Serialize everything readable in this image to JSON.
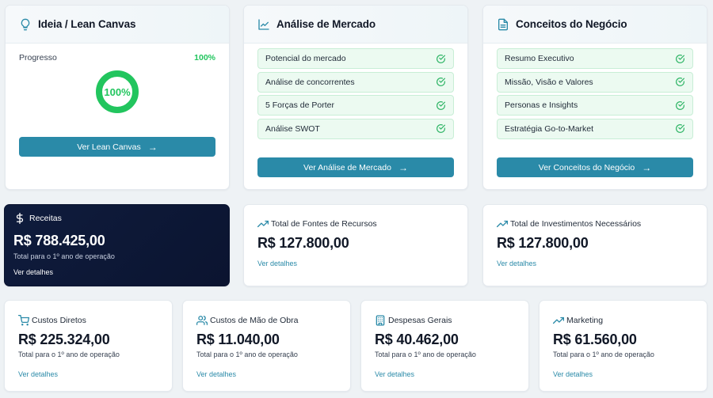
{
  "lean_canvas": {
    "title": "Ideia / Lean Canvas",
    "progress_label": "Progresso",
    "progress_value": "100%",
    "progress_fraction": 1.0,
    "ring_text": "100%",
    "button_label": "Ver Lean Canvas"
  },
  "market": {
    "title": "Análise de Mercado",
    "items": [
      {
        "label": "Potencial do mercado"
      },
      {
        "label": "Análise de concorrentes"
      },
      {
        "label": "5 Forças de Porter"
      },
      {
        "label": "Análise SWOT"
      }
    ],
    "button_label": "Ver Análise de Mercado"
  },
  "business": {
    "title": "Conceitos do Negócio",
    "items": [
      {
        "label": "Resumo Executivo"
      },
      {
        "label": "Missão, Visão e Valores"
      },
      {
        "label": "Personas e Insights"
      },
      {
        "label": "Estratégia Go-to-Market"
      }
    ],
    "button_label": "Ver Conceitos do Negócio"
  },
  "revenue": {
    "title": "Receitas",
    "value": "R$ 788.425,00",
    "sub": "Total para o 1º ano de operação",
    "link": "Ver detalhes"
  },
  "funding": {
    "title": "Total de Fontes de Recursos",
    "value": "R$ 127.800,00",
    "link": "Ver detalhes"
  },
  "investments": {
    "title": "Total de Investimentos Necessários",
    "value": "R$ 127.800,00",
    "link": "Ver detalhes"
  },
  "direct_costs": {
    "title": "Custos Diretos",
    "value": "R$ 225.324,00",
    "sub": "Total para o 1º ano de operação",
    "link": "Ver detalhes"
  },
  "labor_costs": {
    "title": "Custos de Mão de Obra",
    "value": "R$ 11.040,00",
    "sub": "Total para o 1º ano de operação",
    "link": "Ver detalhes"
  },
  "general_expenses": {
    "title": "Despesas Gerais",
    "value": "R$ 40.462,00",
    "sub": "Total para o 1º ano de operação",
    "link": "Ver detalhes"
  },
  "marketing": {
    "title": "Marketing",
    "value": "R$ 61.560,00",
    "sub": "Total para o 1º ano de operação",
    "link": "Ver detalhes"
  },
  "colors": {
    "accent": "#2a8aa8",
    "success": "#22c55e",
    "dark_card": "#0f1c3d"
  },
  "icons": {
    "lean_canvas": "lightbulb-icon",
    "market": "line-chart-icon",
    "business": "document-icon",
    "revenue": "dollar-icon",
    "trend": "trending-up-icon",
    "cart": "cart-icon",
    "users": "users-icon",
    "building": "building-icon",
    "check": "check-circle-icon",
    "arrow": "arrow-right-icon"
  }
}
